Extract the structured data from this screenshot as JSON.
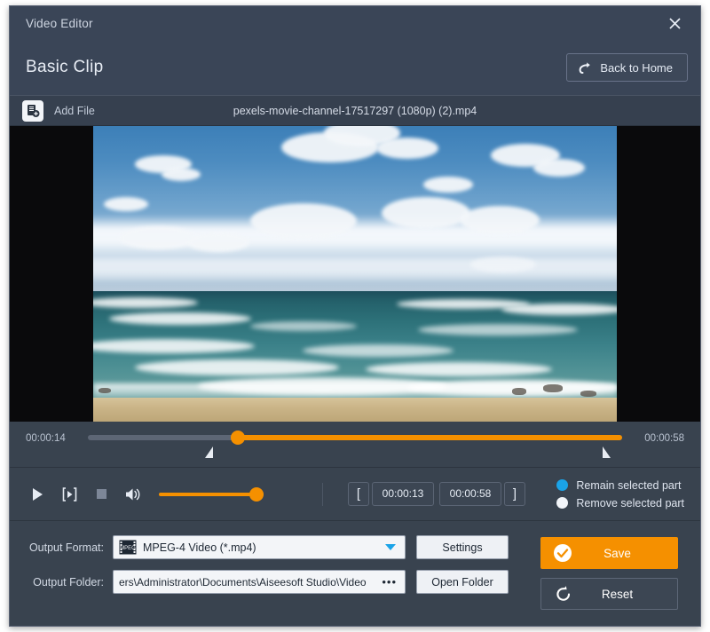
{
  "window": {
    "title": "Video Editor",
    "close_icon": "close-icon"
  },
  "header": {
    "title": "Basic Clip",
    "back_button": {
      "label": "Back to Home",
      "icon": "redo-arrow-icon"
    }
  },
  "filebar": {
    "add_file_label": "Add File",
    "add_file_icon": "add-file-icon",
    "filename": "pexels-movie-channel-17517297 (1080p) (2).mp4"
  },
  "preview": {
    "scene_description": "Ocean beach with blue sky, cumulus clouds, breaking waves and sand"
  },
  "timeline": {
    "current_time": "00:00:14",
    "total_time": "00:00:58",
    "playhead_percent": 28,
    "trim_left_percent": 22,
    "trim_right_percent": 96
  },
  "controls": {
    "play_icon": "play-icon",
    "frame_step_icon": "frame-step-icon",
    "stop_icon": "stop-icon",
    "volume_icon": "volume-icon",
    "volume_percent": 100,
    "trim_start_bracket": "[",
    "trim_end_bracket": "]",
    "start_time": "00:00:13",
    "end_time": "00:00:58",
    "radio_options": [
      {
        "label": "Remain selected part",
        "selected": true
      },
      {
        "label": "Remove selected part",
        "selected": false
      }
    ]
  },
  "output": {
    "format_label": "Output Format:",
    "format_value": "MPEG-4 Video (*.mp4)",
    "format_icon": "mpeg-film-icon",
    "settings_button": "Settings",
    "folder_label": "Output Folder:",
    "folder_value": "ers\\Administrator\\Documents\\Aiseesoft Studio\\Video",
    "browse_button": "•••",
    "open_folder_button": "Open Folder",
    "save_button": "Save",
    "save_icon": "check-circle-icon",
    "reset_button": "Reset",
    "reset_icon": "refresh-ccw-icon"
  },
  "colors": {
    "accent_orange": "#f59000",
    "accent_blue": "#1aa3e8",
    "panel_bg": "#39434f",
    "header_bg": "#3a4557"
  }
}
